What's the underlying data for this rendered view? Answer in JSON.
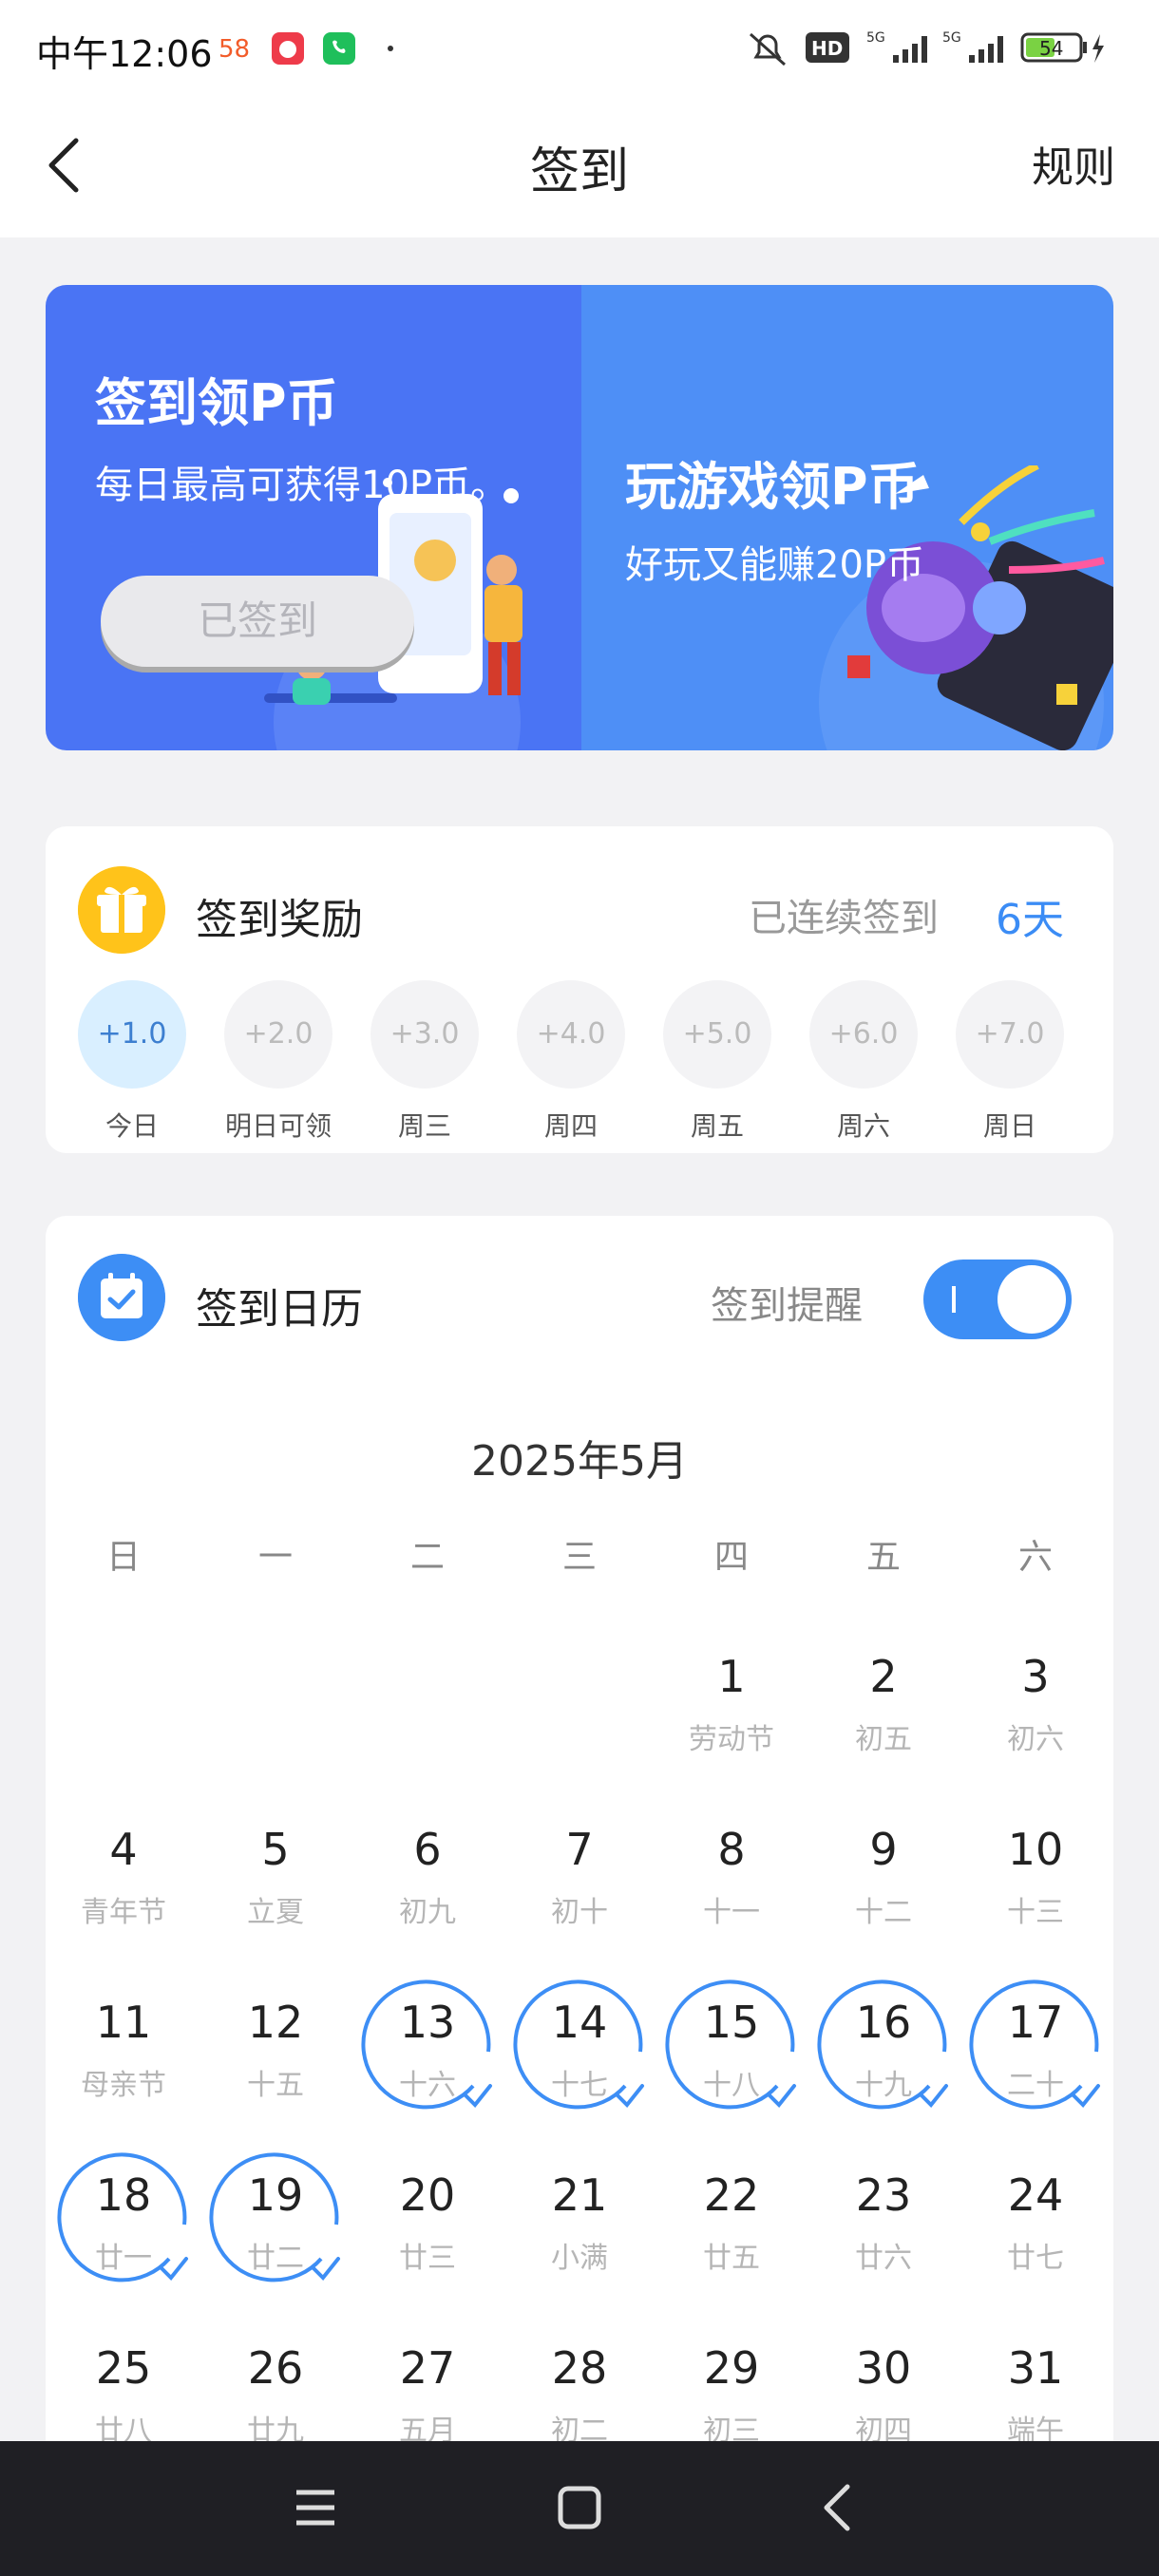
{
  "status_bar": {
    "time": "中午12:06",
    "battery": "54"
  },
  "header": {
    "title": "签到",
    "rules": "规则"
  },
  "banner": {
    "left_title": "签到领P币",
    "left_sub": "每日最高可获得10P币。",
    "signed_button": "已签到",
    "right_title": "玩游戏领P币",
    "right_sub": "好玩又能赚20P币"
  },
  "reward": {
    "title": "签到奖励",
    "streak_label": "已连续签到",
    "streak_days": "6天",
    "days": [
      {
        "amount": "+1.0",
        "label": "今日",
        "today": true
      },
      {
        "amount": "+2.0",
        "label": "明日可领"
      },
      {
        "amount": "+3.0",
        "label": "周三"
      },
      {
        "amount": "+4.0",
        "label": "周四"
      },
      {
        "amount": "+5.0",
        "label": "周五"
      },
      {
        "amount": "+6.0",
        "label": "周六"
      },
      {
        "amount": "+7.0",
        "label": "周日"
      }
    ]
  },
  "calendar": {
    "title": "签到日历",
    "remind_label": "签到提醒",
    "remind_on": true,
    "month": "2025年5月",
    "weekdays": [
      "日",
      "一",
      "二",
      "三",
      "四",
      "五",
      "六"
    ],
    "first_weekday_index": 4,
    "days": [
      {
        "d": "1",
        "sub": "劳动节"
      },
      {
        "d": "2",
        "sub": "初五"
      },
      {
        "d": "3",
        "sub": "初六"
      },
      {
        "d": "4",
        "sub": "青年节"
      },
      {
        "d": "5",
        "sub": "立夏"
      },
      {
        "d": "6",
        "sub": "初九"
      },
      {
        "d": "7",
        "sub": "初十"
      },
      {
        "d": "8",
        "sub": "十一"
      },
      {
        "d": "9",
        "sub": "十二"
      },
      {
        "d": "10",
        "sub": "十三"
      },
      {
        "d": "11",
        "sub": "母亲节"
      },
      {
        "d": "12",
        "sub": "十五"
      },
      {
        "d": "13",
        "sub": "十六",
        "checked": true
      },
      {
        "d": "14",
        "sub": "十七",
        "checked": true
      },
      {
        "d": "15",
        "sub": "十八",
        "checked": true
      },
      {
        "d": "16",
        "sub": "十九",
        "checked": true
      },
      {
        "d": "17",
        "sub": "二十",
        "checked": true
      },
      {
        "d": "18",
        "sub": "廿一",
        "checked": true
      },
      {
        "d": "19",
        "sub": "廿二",
        "checked": true
      },
      {
        "d": "20",
        "sub": "廿三"
      },
      {
        "d": "21",
        "sub": "小满"
      },
      {
        "d": "22",
        "sub": "廿五"
      },
      {
        "d": "23",
        "sub": "廿六"
      },
      {
        "d": "24",
        "sub": "廿七"
      },
      {
        "d": "25",
        "sub": "廿八"
      },
      {
        "d": "26",
        "sub": "廿九"
      },
      {
        "d": "27",
        "sub": "五月"
      },
      {
        "d": "28",
        "sub": "初二"
      },
      {
        "d": "29",
        "sub": "初三"
      },
      {
        "d": "30",
        "sub": "初四"
      },
      {
        "d": "31",
        "sub": "端午"
      }
    ]
  },
  "colors": {
    "accent": "#3d8ef5",
    "banner_left": "#4a74f4",
    "banner_right": "#4e8ff6",
    "gift": "#ffc31a"
  }
}
